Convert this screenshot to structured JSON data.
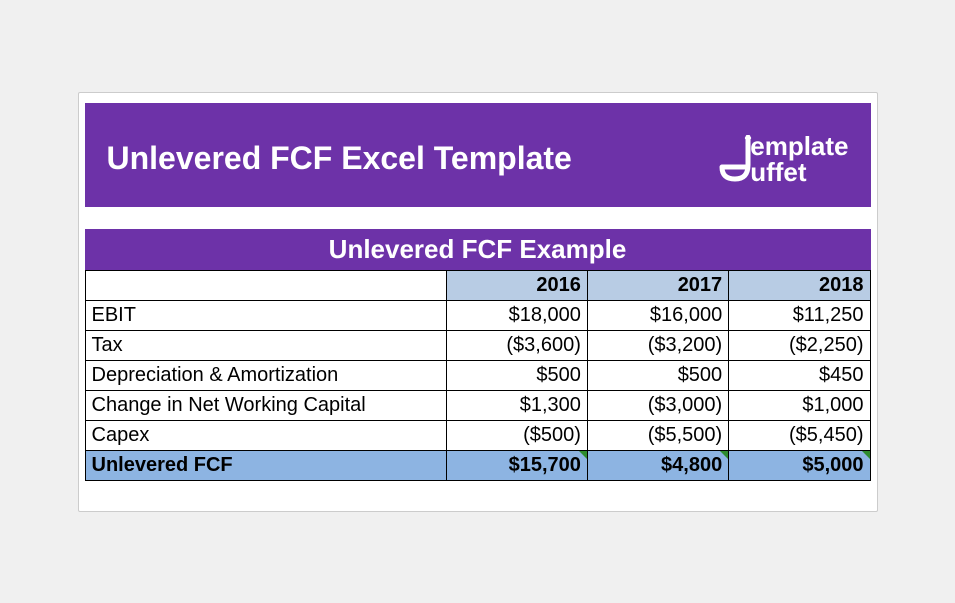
{
  "banner": {
    "title": "Unlevered FCF Excel Template",
    "logo_line1": "emplate",
    "logo_line2": "uffet"
  },
  "subtitle": "Unlevered FCF Example",
  "years": [
    "2016",
    "2017",
    "2018"
  ],
  "rows": [
    {
      "label": "EBIT",
      "vals": [
        "$18,000",
        "$16,000",
        "$11,250"
      ]
    },
    {
      "label": "Tax",
      "vals": [
        "($3,600)",
        "($3,200)",
        "($2,250)"
      ]
    },
    {
      "label": "Depreciation & Amortization",
      "vals": [
        "$500",
        "$500",
        "$450"
      ]
    },
    {
      "label": "Change in Net Working Capital",
      "vals": [
        "$1,300",
        "($3,000)",
        "$1,000"
      ]
    },
    {
      "label": "Capex",
      "vals": [
        "($500)",
        "($5,500)",
        "($5,450)"
      ]
    }
  ],
  "total": {
    "label": "Unlevered FCF",
    "vals": [
      "$15,700",
      "$4,800",
      "$5,000"
    ]
  },
  "chart_data": {
    "type": "table",
    "title": "Unlevered FCF Example",
    "categories": [
      "2016",
      "2017",
      "2018"
    ],
    "series": [
      {
        "name": "EBIT",
        "values": [
          18000,
          16000,
          11250
        ]
      },
      {
        "name": "Tax",
        "values": [
          -3600,
          -3200,
          -2250
        ]
      },
      {
        "name": "Depreciation & Amortization",
        "values": [
          500,
          500,
          450
        ]
      },
      {
        "name": "Change in Net Working Capital",
        "values": [
          1300,
          -3000,
          1000
        ]
      },
      {
        "name": "Capex",
        "values": [
          -500,
          -5500,
          -5450
        ]
      },
      {
        "name": "Unlevered FCF",
        "values": [
          15700,
          4800,
          5000
        ]
      }
    ]
  }
}
